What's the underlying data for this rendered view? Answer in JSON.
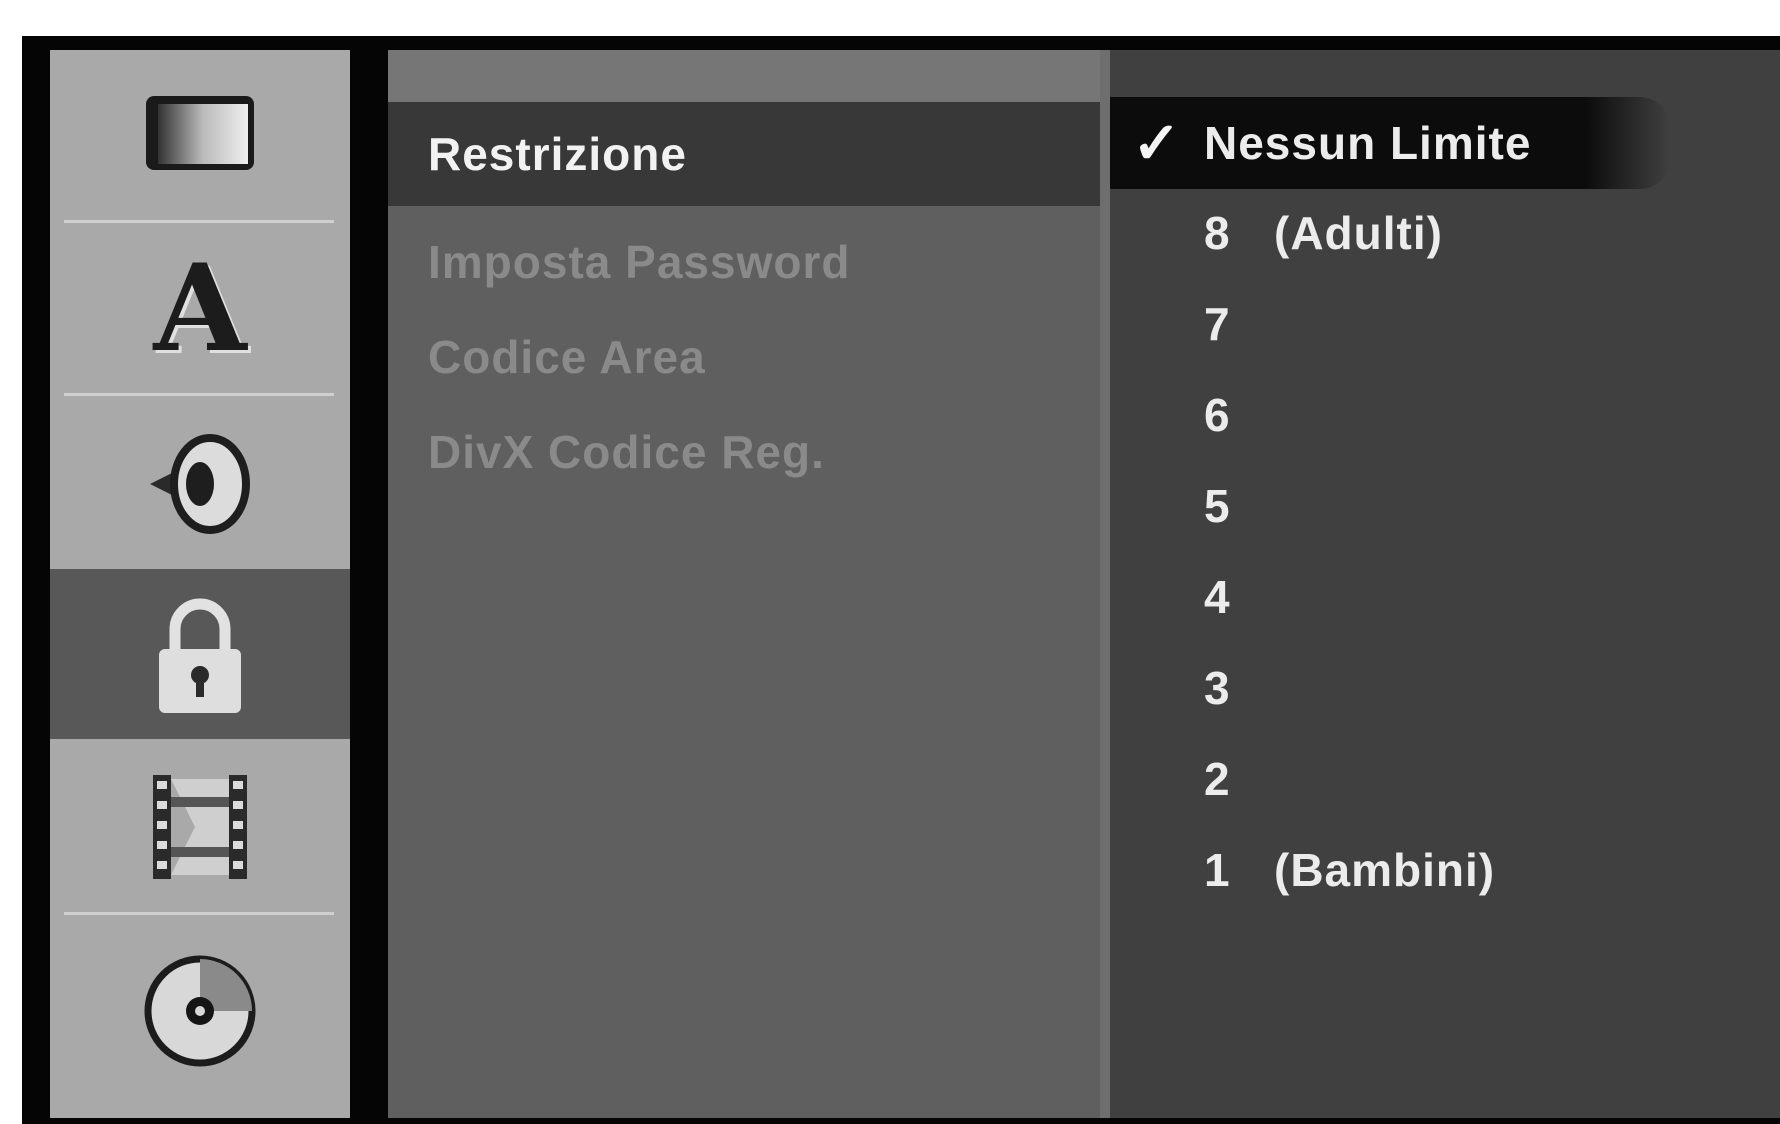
{
  "sidebar": {
    "icons": [
      {
        "name": "display-icon",
        "active": false
      },
      {
        "name": "language-icon",
        "active": false
      },
      {
        "name": "speaker-icon",
        "active": false
      },
      {
        "name": "lock-icon",
        "active": true
      },
      {
        "name": "film-icon",
        "active": false
      },
      {
        "name": "disc-icon",
        "active": false
      }
    ],
    "language_glyph": "A"
  },
  "menu": {
    "items": [
      {
        "label": "Restrizione",
        "selected": true
      },
      {
        "label": "Imposta Password",
        "selected": false
      },
      {
        "label": "Codice Area",
        "selected": false
      },
      {
        "label": "DivX Codice Reg.",
        "selected": false
      }
    ]
  },
  "options": {
    "check_glyph": "✓",
    "items": [
      {
        "number": "",
        "label": "Nessun Limite",
        "selected": true
      },
      {
        "number": "8",
        "label": "(Adulti)",
        "selected": false
      },
      {
        "number": "7",
        "label": "",
        "selected": false
      },
      {
        "number": "6",
        "label": "",
        "selected": false
      },
      {
        "number": "5",
        "label": "",
        "selected": false
      },
      {
        "number": "4",
        "label": "",
        "selected": false
      },
      {
        "number": "3",
        "label": "",
        "selected": false
      },
      {
        "number": "2",
        "label": "",
        "selected": false
      },
      {
        "number": "1",
        "label": "(Bambini)",
        "selected": false
      }
    ]
  },
  "colors": {
    "selected_menu_bg": "#383838",
    "active_icon_bg": "#585858",
    "selected_option_bg": "#0c0c0c"
  }
}
